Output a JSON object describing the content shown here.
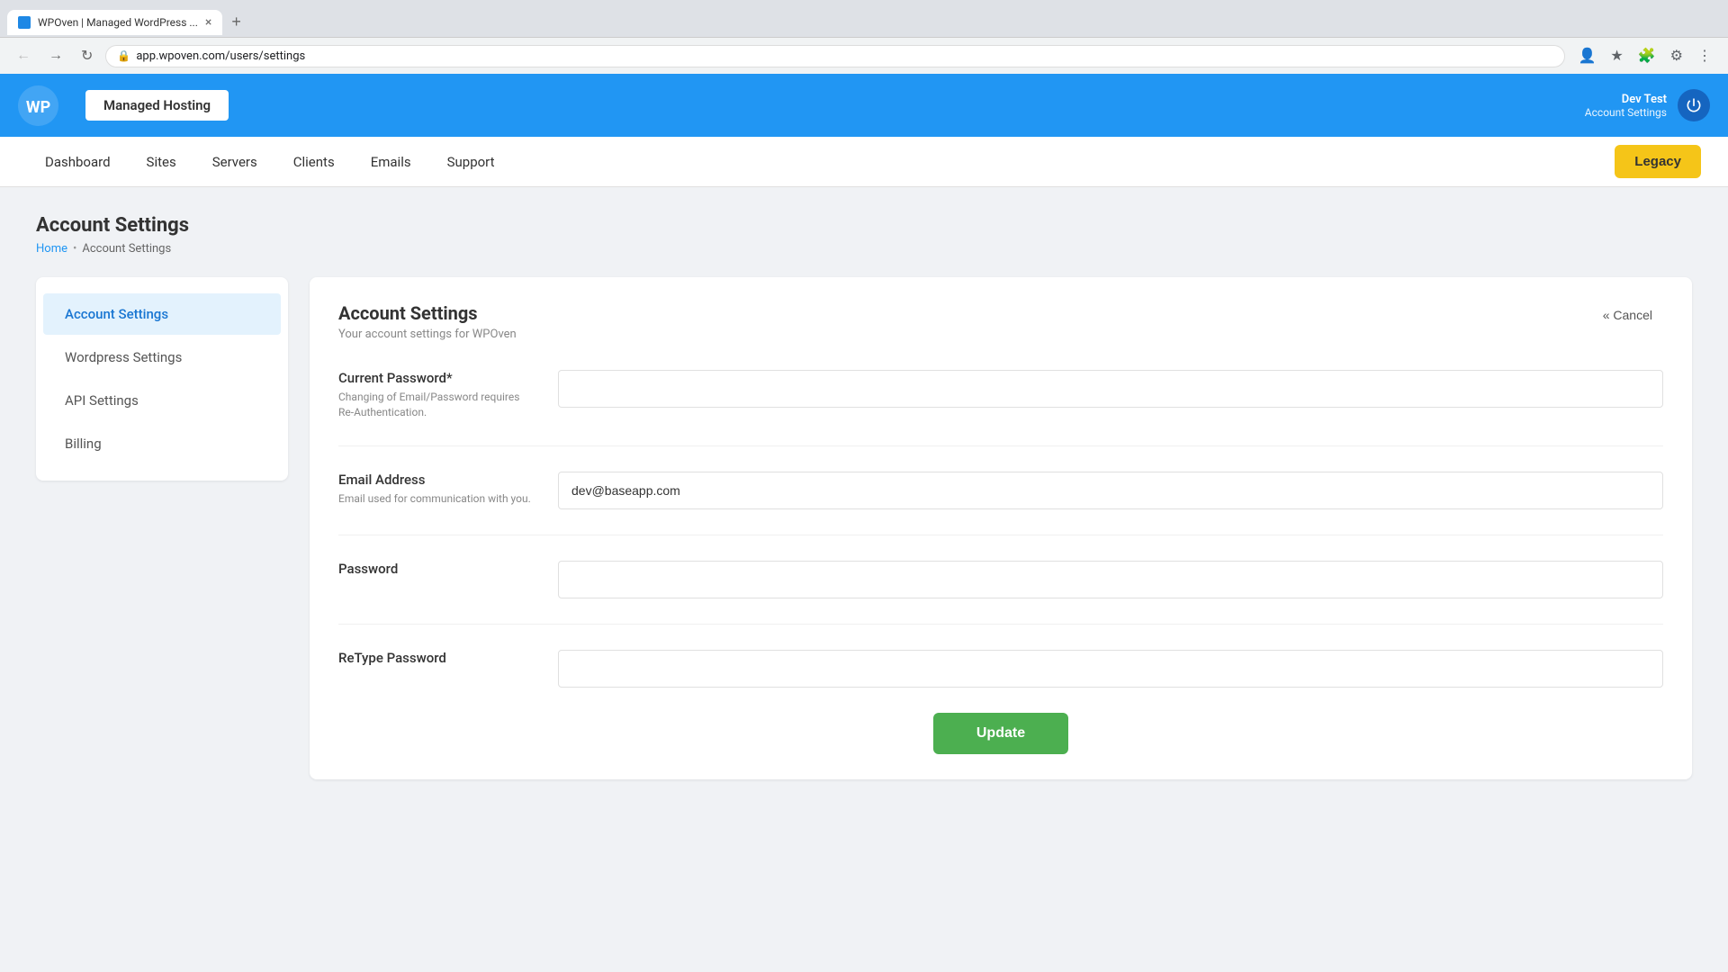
{
  "browser": {
    "tab_title": "WPOven | Managed WordPress ...",
    "tab_close": "×",
    "address": "app.wpoven.com/users/settings",
    "new_tab_label": "+"
  },
  "header": {
    "logo_alt": "WPOven",
    "managed_hosting_label": "Managed Hosting",
    "user_name": "Dev Test",
    "account_settings_link": "Account Settings",
    "power_icon": "power"
  },
  "nav": {
    "items": [
      {
        "label": "Dashboard",
        "href": "#"
      },
      {
        "label": "Sites",
        "href": "#"
      },
      {
        "label": "Servers",
        "href": "#"
      },
      {
        "label": "Clients",
        "href": "#"
      },
      {
        "label": "Emails",
        "href": "#"
      },
      {
        "label": "Support",
        "href": "#"
      }
    ],
    "legacy_button": "Legacy"
  },
  "breadcrumb": {
    "home_label": "Home",
    "separator": "•",
    "current": "Account Settings"
  },
  "page": {
    "title": "Account Settings"
  },
  "sidebar": {
    "items": [
      {
        "label": "Account Settings",
        "active": true
      },
      {
        "label": "Wordpress Settings",
        "active": false
      },
      {
        "label": "API Settings",
        "active": false
      },
      {
        "label": "Billing",
        "active": false
      }
    ]
  },
  "settings_panel": {
    "title": "Account Settings",
    "subtitle": "Your account settings for WPOven",
    "cancel_label": "« Cancel",
    "fields": [
      {
        "label": "Current Password*",
        "hint": "Changing of Email/Password requires Re-Authentication.",
        "type": "password",
        "value": "",
        "placeholder": ""
      },
      {
        "label": "Email Address",
        "hint": "Email used for communication with you.",
        "type": "email",
        "value": "dev@baseapp.com",
        "placeholder": ""
      },
      {
        "label": "Password",
        "hint": "",
        "type": "password",
        "value": "",
        "placeholder": ""
      },
      {
        "label": "ReType Password",
        "hint": "",
        "type": "password",
        "value": "",
        "placeholder": ""
      }
    ],
    "submit_label": "Update"
  }
}
